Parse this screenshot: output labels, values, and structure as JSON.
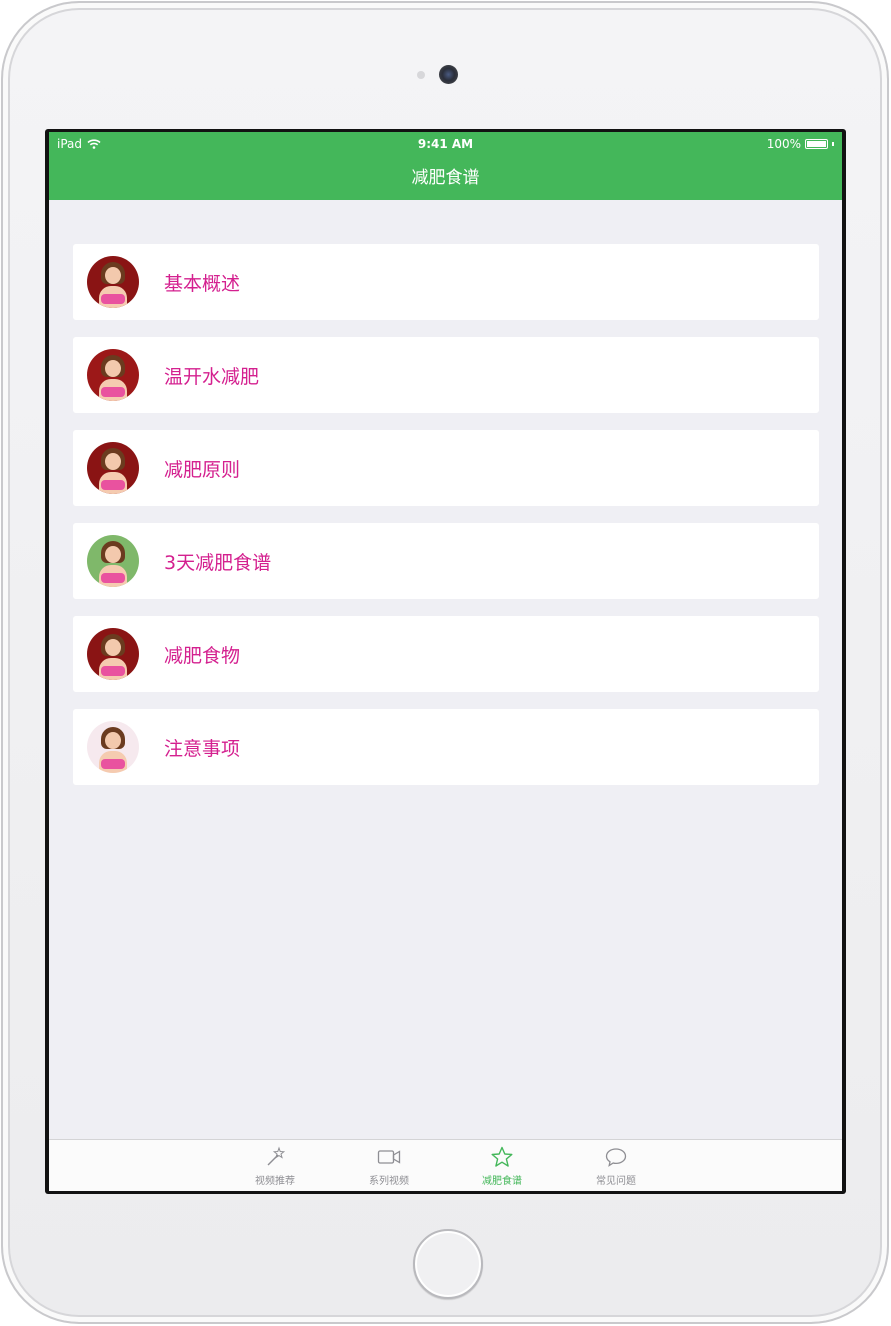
{
  "status_bar": {
    "device": "iPad",
    "time": "9:41 AM",
    "battery": "100%"
  },
  "nav": {
    "title": "减肥食谱"
  },
  "list": [
    {
      "label": "基本概述",
      "avatar_bg": "#8a1414"
    },
    {
      "label": "温开水减肥",
      "avatar_bg": "#9c1818"
    },
    {
      "label": "减肥原则",
      "avatar_bg": "#8a1414"
    },
    {
      "label": "3天减肥食谱",
      "avatar_bg": "#7fb86a"
    },
    {
      "label": "减肥食物",
      "avatar_bg": "#8a1414"
    },
    {
      "label": "注意事项",
      "avatar_bg": "#f6e9ee"
    }
  ],
  "tabs": [
    {
      "label": "视频推荐",
      "icon": "magic-wand-icon",
      "active": false
    },
    {
      "label": "系列视频",
      "icon": "video-camera-icon",
      "active": false
    },
    {
      "label": "减肥食谱",
      "icon": "star-icon",
      "active": true
    },
    {
      "label": "常见问题",
      "icon": "chat-bubble-icon",
      "active": false
    }
  ],
  "colors": {
    "accent": "#44b75a",
    "item_text": "#d4208f",
    "background": "#efeff4"
  }
}
